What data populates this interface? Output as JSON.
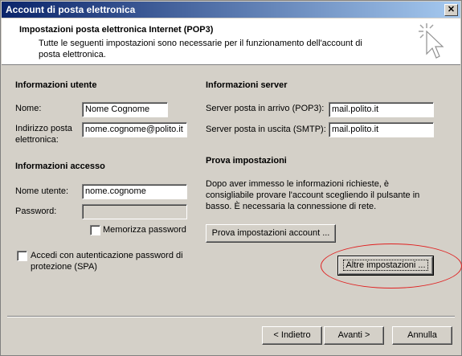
{
  "window": {
    "title": "Account di posta elettronica"
  },
  "header": {
    "title": "Impostazioni posta elettronica Internet (POP3)",
    "desc": "Tutte le seguenti impostazioni sono necessarie per il funzionamento dell'account di posta elettronica."
  },
  "user_info": {
    "heading": "Informazioni utente",
    "name_label": "Nome:",
    "name_value": "Nome Cognome",
    "email_label": "Indirizzo posta elettronica:",
    "email_value": "nome.cognome@polito.it"
  },
  "login_info": {
    "heading": "Informazioni accesso",
    "user_label": "Nome utente:",
    "user_value": "nome.cognome",
    "password_label": "Password:",
    "password_value": "",
    "remember_label": "Memorizza password",
    "spa_label": "Accedi con autenticazione password di protezione (SPA)"
  },
  "server_info": {
    "heading": "Informazioni server",
    "incoming_label": "Server posta in arrivo (POP3):",
    "incoming_value": "mail.polito.it",
    "outgoing_label": "Server posta in uscita (SMTP):",
    "outgoing_value": "mail.polito.it"
  },
  "test": {
    "heading": "Prova impostazioni",
    "desc": "Dopo aver immesso le informazioni richieste, è consigliabile provare l'account scegliendo il pulsante in basso. È necessaria la connessione di rete.",
    "test_button": "Prova impostazioni account ...",
    "more_button": "Altre impostazioni ..."
  },
  "footer": {
    "back_button": "< Indietro",
    "next_button": "Avanti >",
    "cancel_button": "Annulla"
  },
  "colors": {
    "titlebar_start": "#0a246a",
    "titlebar_end": "#a6caf0",
    "highlight_ellipse": "#e02020"
  },
  "icons": {
    "close": "close-icon",
    "wizard": "wizard-cursor-icon"
  }
}
